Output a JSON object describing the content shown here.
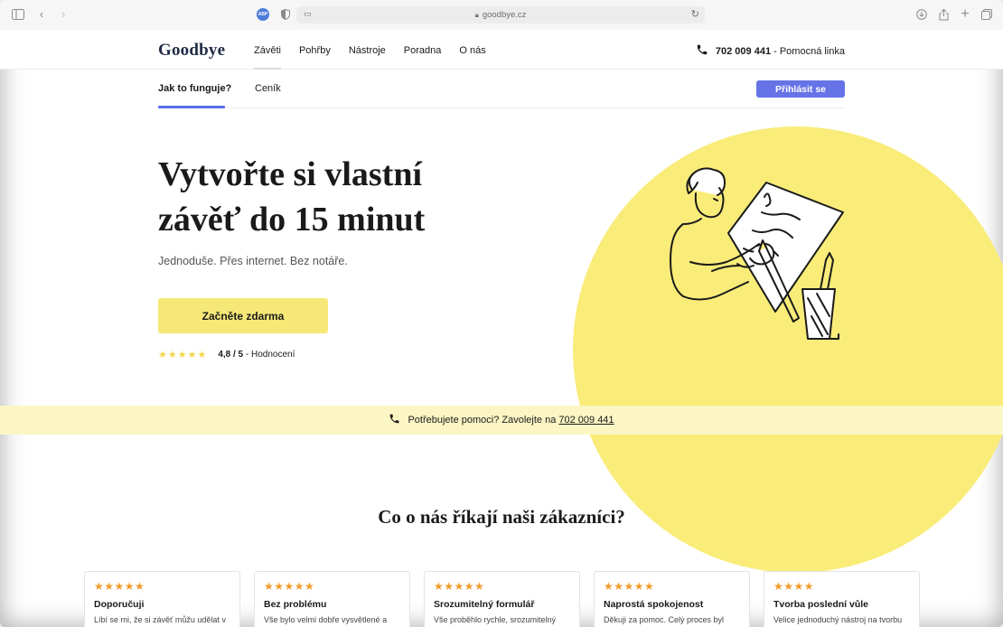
{
  "browser": {
    "url": "goodbye.cz",
    "abp_label": "ABP"
  },
  "header": {
    "logo": "Goodbye",
    "nav": [
      "Závěti",
      "Pohřby",
      "Nástroje",
      "Poradna",
      "O nás"
    ],
    "phone": "702 009 441",
    "phone_suffix": " - Pomocná linka"
  },
  "subnav": {
    "tabs": [
      "Jak to funguje?",
      "Ceník"
    ],
    "login": "Přihlásit se"
  },
  "hero": {
    "title_line1": "Vytvořte si vlastní",
    "title_line2": "závěť do 15 minut",
    "subtitle": "Jednoduše. Přes internet. Bez notáře.",
    "cta": "Začněte zdarma",
    "stars": "★★★★★",
    "rating_value": "4,8 / 5",
    "rating_suffix": " - Hodnocení"
  },
  "help_bar": {
    "text": "Potřebujete pomoci? Zavolejte na ",
    "number": "702 009 441"
  },
  "reviews": {
    "title": "Co o nás říkají naši zákazníci?",
    "cards": [
      {
        "stars": "★★★★★",
        "title": "Doporučuji",
        "text": "Líbí se mi, že si závěť můžu udělat v"
      },
      {
        "stars": "★★★★★",
        "title": "Bez problému",
        "text": "Vše bylo velmi dobře vysvětlené a"
      },
      {
        "stars": "★★★★★",
        "title": "Srozumitelný formulář",
        "text": "Vše proběhlo rychle, srozumitelný"
      },
      {
        "stars": "★★★★★",
        "title": "Naprostá spokojenost",
        "text": "Děkuji za pomoc. Celý proces byl"
      },
      {
        "stars": "★★★★",
        "title": "Tvorba poslední vůle",
        "text": "Velice jednoduchý nástroj na tvorbu"
      }
    ]
  },
  "colors": {
    "accent_blue": "#6673e6",
    "yellow": "#f9ec79",
    "cta_yellow": "#f6e877",
    "banner_yellow": "#fbf6c4",
    "star_orange": "#f39a2b"
  }
}
